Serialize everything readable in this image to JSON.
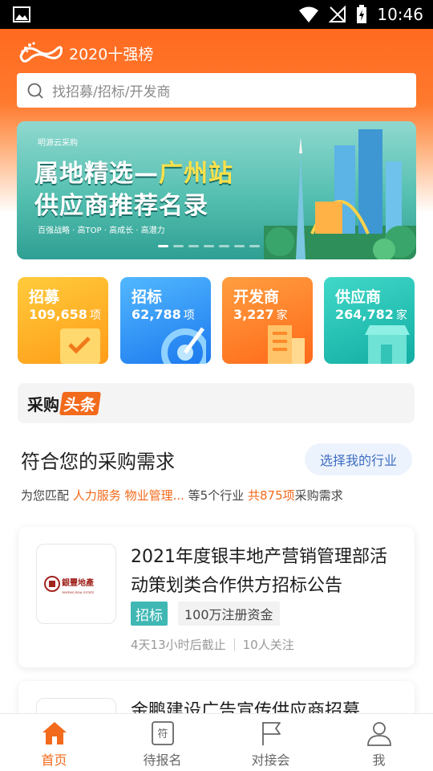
{
  "status_bar": {
    "time": "10:46"
  },
  "header": {
    "title": "2020十强榜"
  },
  "search": {
    "placeholder": "找招募/招标/开发商"
  },
  "banner": {
    "brand": "明源云采购",
    "line1_a": "属地精选—",
    "line1_b": "广州站",
    "line2": "供应商推荐名录",
    "sub": "百强战略 · 高TOP · 高成长 · 高潜力",
    "dot_count": 7,
    "active_dot": 0
  },
  "categories": [
    {
      "name": "招募",
      "count": "109,658",
      "unit": "项",
      "color_from": "#ffc23a",
      "color_to": "#ff9a1a"
    },
    {
      "name": "招标",
      "count": "62,788",
      "unit": "项",
      "color_from": "#4ab2ff",
      "color_to": "#1e7cf0"
    },
    {
      "name": "开发商",
      "count": "3,227",
      "unit": "家",
      "color_from": "#ff9a3c",
      "color_to": "#ff6a1a"
    },
    {
      "name": "供应商",
      "count": "264,782",
      "unit": "家",
      "color_from": "#3fd6c6",
      "color_to": "#15b0a6"
    }
  ],
  "toutiao": {
    "a": "采购",
    "b": "头条"
  },
  "section": {
    "title": "符合您的采购需求",
    "pick_button": "选择我的行业",
    "match_prefix": "为您匹配",
    "match_industries": "人力服务 物业管理...",
    "match_mid": "等5个行业",
    "match_total": "共875项",
    "match_suffix": "采购需求"
  },
  "cards": [
    {
      "title": "2021年度银丰地产营销管理部活动策划类合作供方招标公告",
      "logo_text": "銀豐地產",
      "logo_sub": "YINFENG REAL ESTATE",
      "tag": "招标",
      "capital": "100万注册资金",
      "deadline": "4天13小时后截止",
      "followers": "10人关注"
    },
    {
      "title": "金鹏建设广告宣传供应商招募"
    }
  ],
  "tabs": [
    {
      "label": "首页",
      "active": true
    },
    {
      "label": "待报名",
      "icon_text": "符"
    },
    {
      "label": "对接会"
    },
    {
      "label": "我"
    }
  ],
  "colors": {
    "accent": "#f26a1b",
    "header": "#ff6a1f",
    "link_blue": "#3f6fc1",
    "tag_teal": "#3fb7b3"
  }
}
